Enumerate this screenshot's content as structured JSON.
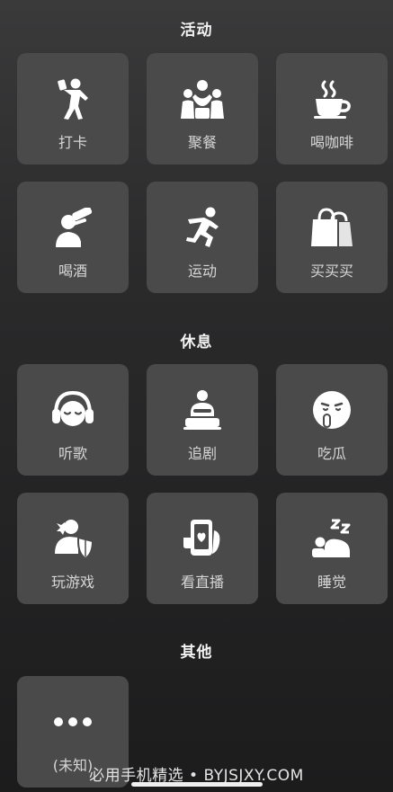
{
  "sections": [
    {
      "title": "活动",
      "items": [
        {
          "label": "打卡",
          "icon": "check-in-icon"
        },
        {
          "label": "聚餐",
          "icon": "group-dinner-icon"
        },
        {
          "label": "喝咖啡",
          "icon": "coffee-cup-icon"
        },
        {
          "label": "喝酒",
          "icon": "drinking-icon"
        },
        {
          "label": "运动",
          "icon": "running-icon"
        },
        {
          "label": "买买买",
          "icon": "shopping-bag-icon"
        }
      ]
    },
    {
      "title": "休息",
      "items": [
        {
          "label": "听歌",
          "icon": "headphones-icon"
        },
        {
          "label": "追剧",
          "icon": "tv-watching-icon"
        },
        {
          "label": "吃瓜",
          "icon": "shushing-face-icon"
        },
        {
          "label": "玩游戏",
          "icon": "gaming-shield-icon"
        },
        {
          "label": "看直播",
          "icon": "live-stream-phone-icon"
        },
        {
          "label": "睡觉",
          "icon": "sleeping-icon"
        }
      ]
    },
    {
      "title": "其他",
      "items": [
        {
          "label": "(未知)",
          "icon": "more-dots-icon"
        }
      ]
    }
  ],
  "watermark": "必用手机精选 • BYJSJXY.COM",
  "colors": {
    "tile_background": "#4a4a4b",
    "icon": "#ffffff",
    "label": "#d6d6d6"
  }
}
